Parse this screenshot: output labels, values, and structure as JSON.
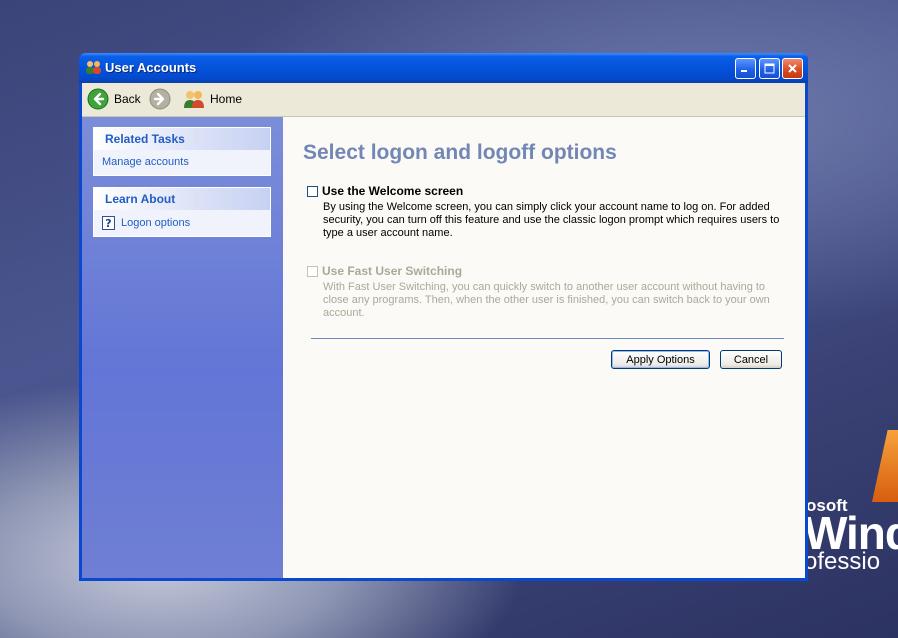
{
  "window": {
    "title": "User Accounts"
  },
  "toolbar": {
    "back_label": "Back",
    "home_label": "Home"
  },
  "sidebar": {
    "related_tasks": {
      "title": "Related Tasks",
      "items": [
        {
          "label": "Manage accounts"
        }
      ]
    },
    "learn_about": {
      "title": "Learn About",
      "items": [
        {
          "label": "Logon options",
          "icon": "help-icon"
        }
      ]
    }
  },
  "main": {
    "title": "Select logon and logoff options",
    "options": [
      {
        "label": "Use the Welcome screen",
        "checked": false,
        "enabled": true,
        "description": "By using the Welcome screen, you can simply click your account name to log on. For added security, you can turn off this feature and use the classic logon prompt which requires users to type a user account name."
      },
      {
        "label": "Use Fast User Switching",
        "checked": false,
        "enabled": false,
        "description": "With Fast User Switching, you can quickly switch to another user account without having to close any programs. Then, when the other user is finished, you can switch back to your own account."
      }
    ],
    "apply_label": "Apply Options",
    "cancel_label": "Cancel"
  },
  "wallpaper": {
    "brand_small": "osoft",
    "brand_big": "Windo",
    "brand_mid": "ofessio"
  },
  "colors": {
    "title_bar": "#0552da",
    "sidebar": "#6375d6",
    "heading": "#7287b5",
    "link": "#215dc6"
  }
}
